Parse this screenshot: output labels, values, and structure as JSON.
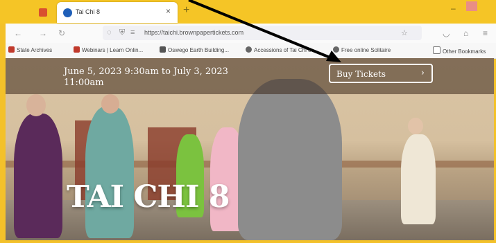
{
  "browser": {
    "tab": {
      "title": "Tai Chi 8"
    },
    "url": "https://taichi.brownpapertickets.com",
    "bookmarks": [
      "State Archives",
      "Webinars | Learn Onlin...",
      "Oswego Earth Building...",
      "Accessions of Tai Chi 8",
      "Free online Solitaire",
      "Other Bookmarks"
    ]
  },
  "event": {
    "date_line": "June 5, 2023 9:30am to July 3, 2023 11:00am",
    "buy_label": "Buy Tickets",
    "title": "TAI CHI 8"
  },
  "colors": {
    "browser_frame": "#f5c526",
    "banner_overlay": "#3c2819"
  },
  "icons": [
    "back-icon",
    "forward-icon",
    "reload-icon",
    "shield-icon",
    "lock-icon",
    "star-icon",
    "chevron-right-icon",
    "arrow-annotation-icon"
  ]
}
